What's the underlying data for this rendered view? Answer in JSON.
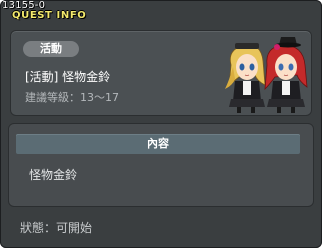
{
  "window": {
    "quest_id": "13155-0",
    "title": "QUEST INFO"
  },
  "quest": {
    "category": "活動",
    "name": "[活動] 怪物金鈴",
    "level_requirement": "建議等級：13～17"
  },
  "content": {
    "header": "內容",
    "text": "怪物金鈴"
  },
  "status": {
    "label": "狀態：",
    "value": "可開始"
  },
  "portrait": {
    "icon": "npc-twin-girls-portrait"
  },
  "colors": {
    "title": "#f2e96c",
    "window_bg": "#3a3e40",
    "panel_bg": "#4b5053",
    "header_bg": "#5b6c74"
  }
}
